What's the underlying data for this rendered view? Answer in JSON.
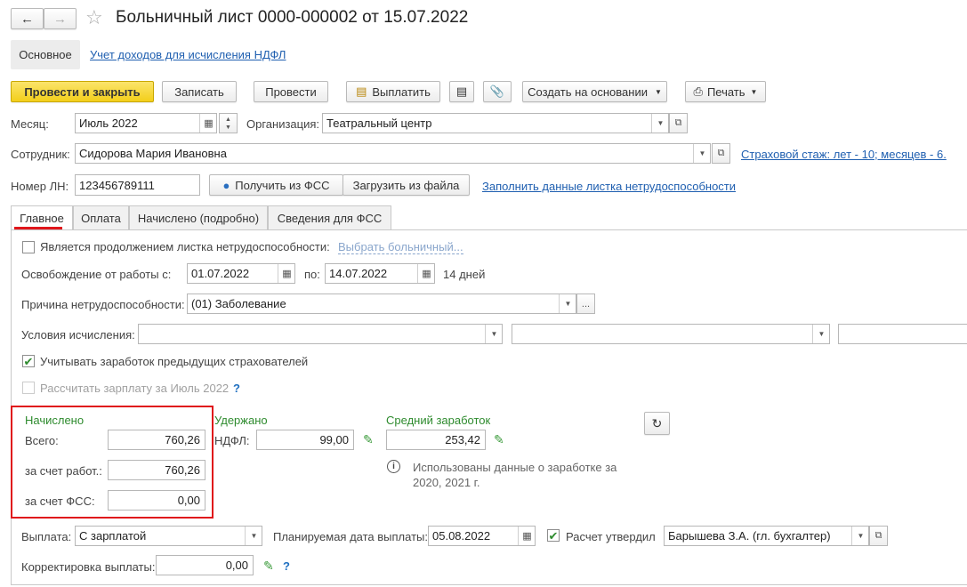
{
  "nav": {
    "back_icon": "arrow-left-icon",
    "forward_icon": "arrow-right-icon",
    "star_icon": "star-icon"
  },
  "title": "Больничный лист 0000-000002 от 15.07.2022",
  "sections": {
    "main": "Основное",
    "ndfl_link": "Учет доходов для исчисления НДФЛ"
  },
  "toolbar": {
    "post_close": "Провести и закрыть",
    "save": "Записать",
    "post": "Провести",
    "pay": "Выплатить",
    "create_based": "Создать на основании",
    "print": "Печать"
  },
  "header": {
    "month_label": "Месяц:",
    "month_value": "Июль 2022",
    "org_label": "Организация:",
    "org_value": "Театральный центр",
    "employee_label": "Сотрудник:",
    "employee_value": "Сидорова Мария Ивановна",
    "insurance_link": "Страховой стаж: лет - 10; месяцев - 6.",
    "ln_label": "Номер ЛН:",
    "ln_value": "123456789111",
    "get_fss": "Получить из ФСС",
    "load_file": "Загрузить из файла",
    "fill_link": "Заполнить данные листка нетрудоспособности"
  },
  "tabs": [
    "Главное",
    "Оплата",
    "Начислено (подробно)",
    "Сведения для ФСС"
  ],
  "main": {
    "continuation_label": "Является продолжением листка нетрудоспособности:",
    "choose_sick": "Выбрать больничный...",
    "release_label": "Освобождение от работы с:",
    "date_from": "01.07.2022",
    "to_label": "по:",
    "date_to": "14.07.2022",
    "days": "14 дней",
    "reason_label": "Причина нетрудоспособности:",
    "reason_value": "(01) Заболевание",
    "conditions_label": "Условия исчисления:",
    "prev_insurers_label": "Учитывать заработок предыдущих страхователей",
    "calc_salary_label": "Рассчитать зарплату за Июль 2022",
    "accrued_title": "Начислено",
    "total_label": "Всего:",
    "total_value": "760,26",
    "employer_label": "за счет работ.:",
    "employer_value": "760,26",
    "fss_label": "за счет ФСС:",
    "fss_value": "0,00",
    "withheld_title": "Удержано",
    "ndfl_label": "НДФЛ:",
    "ndfl_value": "99,00",
    "avg_title": "Средний заработок",
    "avg_value": "253,42",
    "info_text_1": "Использованы данные о заработке за",
    "info_text_2": "2020,  2021 г.",
    "payment_label": "Выплата:",
    "payment_value": "С зарплатой",
    "planned_date_label": "Планируемая дата выплаты:",
    "planned_date_value": "05.08.2022",
    "approved_label": "Расчет утвердил",
    "approved_value": "Барышева З.А. (гл. бухгалтер)",
    "correction_label": "Корректировка выплаты:",
    "correction_value": "0,00"
  },
  "colors": {
    "primary_button": "#f3cf1a",
    "link": "#1f5fb0",
    "highlight_box": "#e0161b",
    "green": "#2e8b2e"
  }
}
